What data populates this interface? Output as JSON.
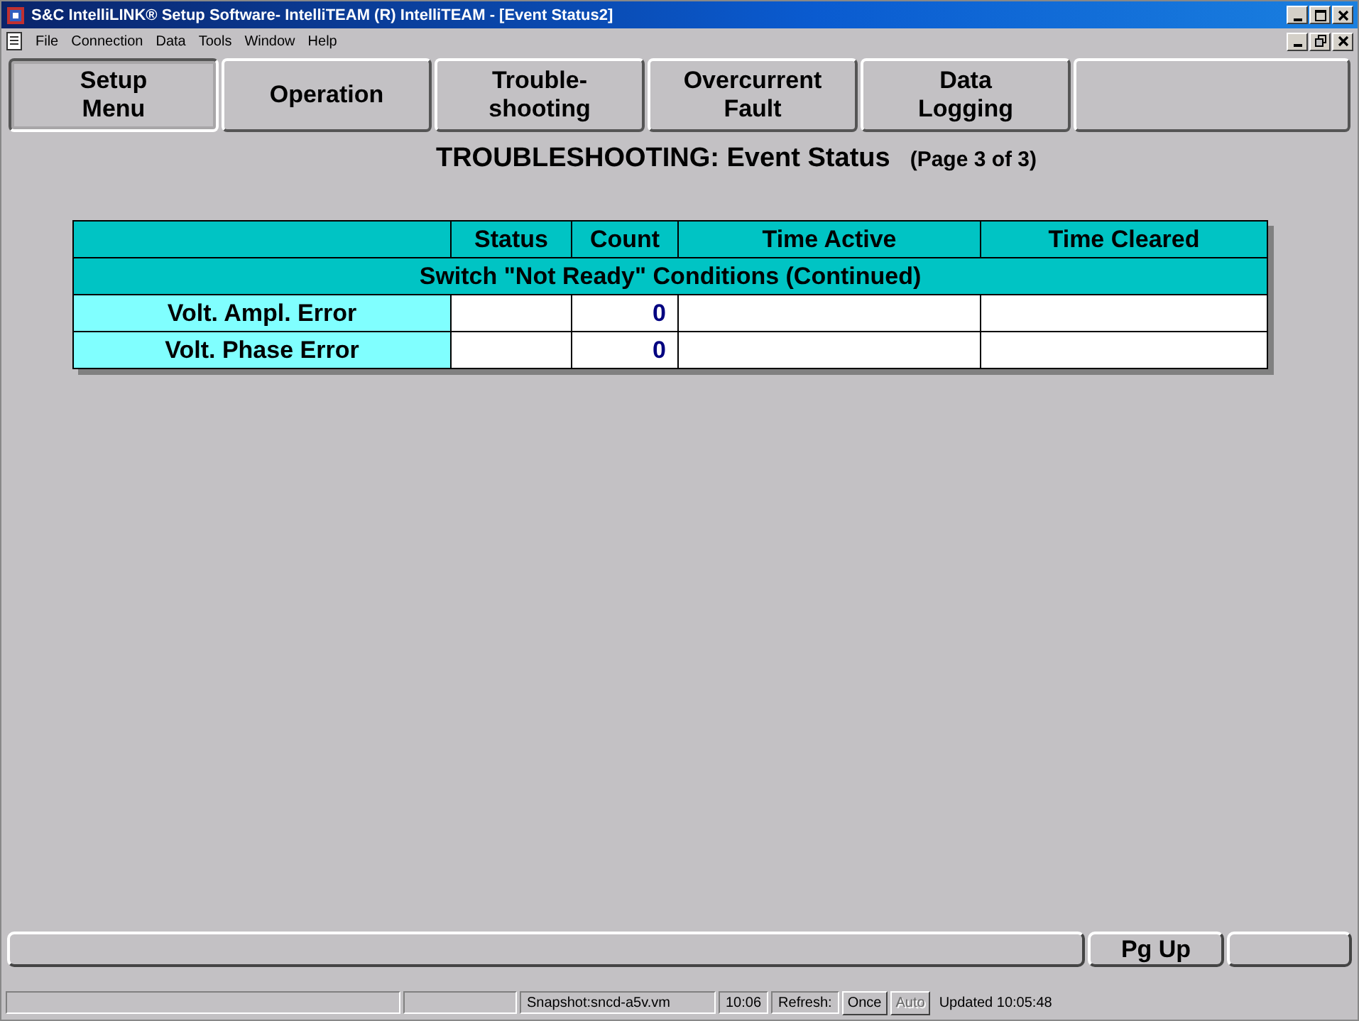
{
  "window": {
    "title": "S&C IntelliLINK® Setup Software- IntelliTEAM (R) IntelliTEAM - [Event Status2]"
  },
  "menu": [
    "File",
    "Connection",
    "Data",
    "Tools",
    "Window",
    "Help"
  ],
  "nav_buttons": [
    {
      "label": "Setup\nMenu",
      "selected": true
    },
    {
      "label": "Operation",
      "selected": false
    },
    {
      "label": "Trouble-\nshooting",
      "selected": false
    },
    {
      "label": "Overcurrent\nFault",
      "selected": false
    },
    {
      "label": "Data\nLogging",
      "selected": false
    },
    {
      "selected": false
    }
  ],
  "heading": {
    "title": "TROUBLESHOOTING: Event Status",
    "page": "(Page 3 of 3)"
  },
  "table": {
    "columns": [
      "Status",
      "Count",
      "Time Active",
      "Time Cleared"
    ],
    "section": "Switch \"Not Ready\" Conditions (Continued)",
    "rows": [
      {
        "label": "Volt. Ampl. Error",
        "count": "0"
      },
      {
        "label": "Volt. Phase Error",
        "count": "0"
      }
    ]
  },
  "bottom_buttons": [
    "Pg Up"
  ],
  "status_bar": {
    "snapshot": "Snapshot:sncd-a5v.vm",
    "time": "10:06",
    "refresh_label": "Refresh:",
    "once": {
      "label": "Once",
      "disabled": false
    },
    "auto": {
      "label": "Auto",
      "disabled": true
    },
    "updated": "Updated 10:05:48"
  }
}
